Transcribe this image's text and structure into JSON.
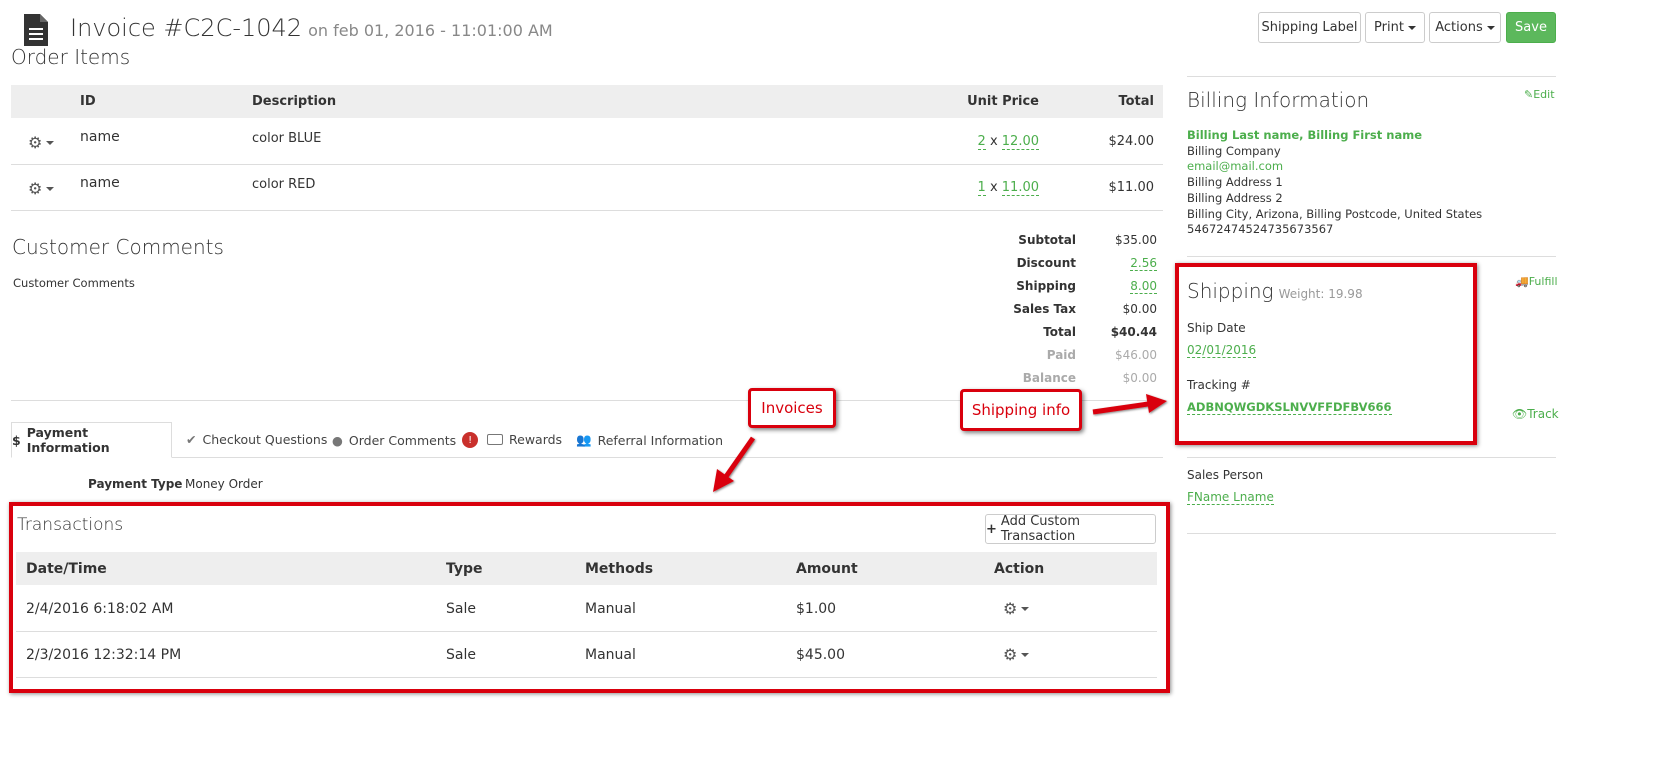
{
  "header": {
    "title": "Invoice #C2C-1042",
    "date": "on feb 01, 2016 - 11:01:00 AM",
    "buttons": {
      "shipping_label": "Shipping Label",
      "print": "Print",
      "actions": "Actions",
      "save": "Save"
    }
  },
  "order_items": {
    "title": "Order Items",
    "columns": {
      "id": "ID",
      "description": "Description",
      "unit_price": "Unit Price",
      "total": "Total"
    },
    "rows": [
      {
        "id": "name",
        "description": "color BLUE",
        "qty": "2",
        "x": "x",
        "price": "12.00",
        "total": "$24.00"
      },
      {
        "id": "name",
        "description": "color RED",
        "qty": "1",
        "x": "x",
        "price": "11.00",
        "total": "$11.00"
      }
    ]
  },
  "customer_comments": {
    "title": "Customer Comments",
    "text": "Customer Comments"
  },
  "totals": {
    "subtotal_label": "Subtotal",
    "subtotal": "$35.00",
    "discount_label": "Discount",
    "discount": "2.56",
    "shipping_label": "Shipping",
    "shipping": "8.00",
    "tax_label": "Sales Tax",
    "tax": "$0.00",
    "total_label": "Total",
    "total": "$40.44",
    "paid_label": "Paid",
    "paid": "$46.00",
    "balance_label": "Balance",
    "balance": "$0.00"
  },
  "tabs": {
    "payment": "Payment Information",
    "checkout": "Checkout Questions",
    "order_comments": "Order Comments",
    "order_comments_badge": "!",
    "rewards": "Rewards",
    "referral": "Referral Information"
  },
  "payment": {
    "type_label": "Payment Type",
    "type_value": "Money Order"
  },
  "transactions": {
    "title": "Transactions",
    "add_button": "Add Custom Transaction",
    "columns": {
      "datetime": "Date/Time",
      "type": "Type",
      "methods": "Methods",
      "amount": "Amount",
      "action": "Action"
    },
    "rows": [
      {
        "datetime": "2/4/2016 6:18:02 AM",
        "type": "Sale",
        "method": "Manual",
        "amount": "$1.00"
      },
      {
        "datetime": "2/3/2016 12:32:14 PM",
        "type": "Sale",
        "method": "Manual",
        "amount": "$45.00"
      }
    ]
  },
  "billing": {
    "title": "Billing Information",
    "edit": "Edit",
    "name": "Billing Last name, Billing First name",
    "company": "Billing Company",
    "email": "email@mail.com",
    "address1": "Billing Address 1",
    "address2": "Billing Address 2",
    "city_line": "Billing City, Arizona, Billing Postcode, United States",
    "phone": "54672474524735673567"
  },
  "shipping": {
    "title": "Shipping",
    "weight": "Weight: 19.98",
    "fulfill": "Fulfill",
    "ship_date_label": "Ship Date",
    "ship_date": "02/01/2016",
    "tracking_label": "Tracking #",
    "tracking": "ADBNQWGDKSLNVVFFDFBV666",
    "track": "Track"
  },
  "sales_person": {
    "label": "Sales Person",
    "value": "FName Lname"
  },
  "annotations": {
    "invoices": "Invoices",
    "shipping_info": "Shipping info"
  },
  "colors": {
    "accent_green": "#4cae4c",
    "annotation_red": "#d9000d",
    "header_gray": "#eeeeee",
    "badge_red": "#c9302c"
  }
}
